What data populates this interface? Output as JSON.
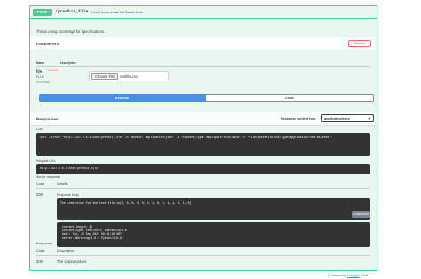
{
  "operation": {
    "method": "POST",
    "path": "/predict_file",
    "summary": "Let's Humanimate the Banks Note",
    "description": "This is using docstrings for specifications."
  },
  "parameters": {
    "title": "Parameters",
    "cancel_label": "Cancel",
    "col_name": "Name",
    "col_description": "Description",
    "param_name": "file",
    "param_required": "* required",
    "param_type": "file",
    "param_in": "(formData)",
    "choose_file_label": "Choose File",
    "file_value": "testfile.csv"
  },
  "actions": {
    "execute_label": "Execute",
    "clear_label": "Clear"
  },
  "responses": {
    "title": "Responses",
    "content_type_label": "Response content type",
    "content_type_value": "application/json",
    "curl_label": "Curl",
    "curl_command": "curl -X POST \"http://127.0.0.1:5000/predict_file\" -H \"accept: application/json\" -H \"Content-Type: multipart/form-data\" -F \"file=@testfile.csv;type=application/vnd.ms-excel\"",
    "request_url_label": "Request URL",
    "request_url": "http://127.0.0.1:5000/predict_file",
    "server_response_label": "Server response",
    "col_code": "Code",
    "col_details": "Details",
    "server_code": "200",
    "response_body_label": "Response body",
    "response_body": "The prediction for the test file is[0, 0, 0, 0, 0, 0, 1, 0, 0, 1, 1, 0, 1, 0]",
    "download_label": "Download",
    "response_headers_label": "Response headers",
    "response_headers": " content-length: 85 \n content-type: text/html; charset=utf-8 \n date: Tue, 14 Sep 2021 06:33:19 GMT \n server: Werkzeug/2.0.1 Python/3.8.8 ",
    "responses_label": "Responses",
    "doc_code": "200",
    "doc_description": "The output values"
  },
  "footer": {
    "powered_prefix": "[ Powered by ",
    "powered_link": "Flasgger",
    "powered_suffix": " 0.9.5 ]"
  },
  "colors": {
    "post_green": "#49cc90",
    "execute_blue": "#4990e2",
    "cancel_red": "#ff6060",
    "code_bg": "#333333"
  }
}
